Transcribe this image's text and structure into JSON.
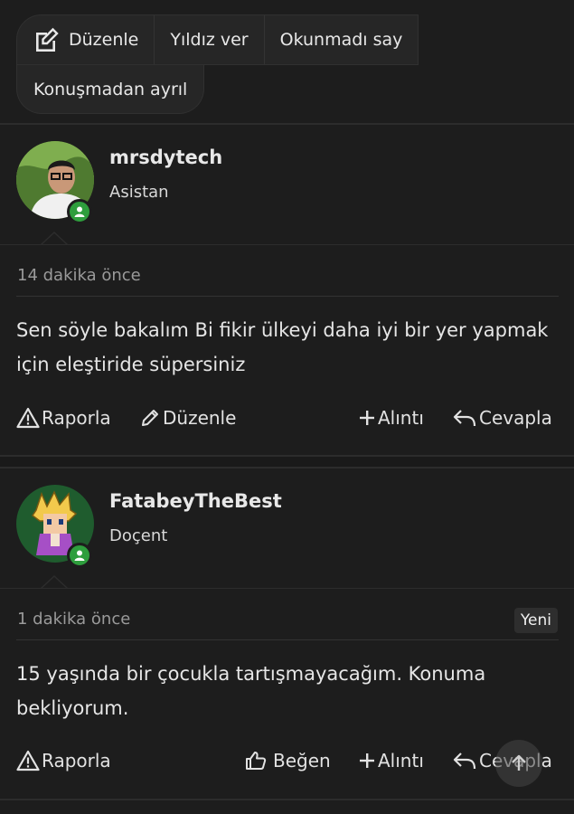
{
  "topic_actions": {
    "edit": "Düzenle",
    "star": "Yıldız ver",
    "mark_unread": "Okunmadı say",
    "leave": "Konuşmadan ayrıl"
  },
  "posts": [
    {
      "username": "mrsdytech",
      "role": "Asistan",
      "time": "14 dakika önce",
      "text": "Sen söyle bakalım Bi fikir ülkeyi daha iyi bir yer yapmak için eleştiride süpersiniz",
      "actions": {
        "report": "Raporla",
        "edit": "Düzenle",
        "quote": "Alıntı",
        "reply": "Cevapla"
      }
    },
    {
      "username": "FatabeyTheBest",
      "role": "Doçent",
      "time": "1 dakika önce",
      "badge": "Yeni",
      "text": "15 yaşında bir çocukla tartışmayacağım. Konuma bekliyorum.",
      "actions": {
        "report": "Raporla",
        "like": "Beğen",
        "quote": "Alıntı",
        "reply": "Cevapla"
      }
    }
  ],
  "colors": {
    "background": "#1d1d1d",
    "online": "#2e9e3d",
    "text": "#e6e6e6",
    "muted": "#9a9a9a"
  }
}
